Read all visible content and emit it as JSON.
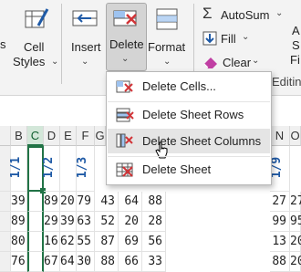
{
  "ribbon": {
    "cells_group": {
      "s_partial": "s",
      "cell_styles_line1": "Cell",
      "cell_styles_line2": "Styles"
    },
    "insert": "Insert",
    "delete": "Delete",
    "format": "Format",
    "autosum": "AutoSum",
    "fill": "Fill",
    "clear": "Clear",
    "editing_partial": "Editing",
    "right_partial": [
      "A",
      "S",
      "Fi"
    ],
    "chevron": "⌄"
  },
  "menu": {
    "items": [
      {
        "label": "Delete Cells...",
        "icon": "delete-cells-icon"
      },
      {
        "label": "Delete Sheet Rows",
        "icon": "delete-sheet-rows-icon"
      },
      {
        "label": "Delete Sheet Columns",
        "icon": "delete-sheet-columns-icon"
      },
      {
        "label": "Delete Sheet",
        "icon": "delete-sheet-icon"
      }
    ],
    "hovered_index": 2
  },
  "grid": {
    "columns": [
      "B",
      "C",
      "D",
      "E",
      "F",
      "G",
      "H",
      "I",
      "J",
      "K",
      "L",
      "M",
      "N",
      "O"
    ],
    "selected_column": "C",
    "header_row": [
      "1/1",
      "",
      "1/2",
      "",
      "1/3",
      "",
      "",
      "",
      "",
      "",
      "",
      "",
      "1/9",
      ""
    ],
    "rows": [
      [
        "39",
        "",
        "89",
        "20",
        "79",
        "43",
        "64",
        "88",
        "27",
        "27"
      ],
      [
        "89",
        "",
        "29",
        "39",
        "63",
        "52",
        "20",
        "28",
        "99",
        "95"
      ],
      [
        "80",
        "",
        "16",
        "62",
        "55",
        "87",
        "69",
        "56",
        "13",
        "20"
      ],
      [
        "76",
        "",
        "67",
        "64",
        "30",
        "88",
        "66",
        "33",
        "88",
        "20"
      ]
    ]
  },
  "colors": {
    "accent": "#217346",
    "delete_red": "#d13438",
    "blue": "#1f5aa6"
  }
}
